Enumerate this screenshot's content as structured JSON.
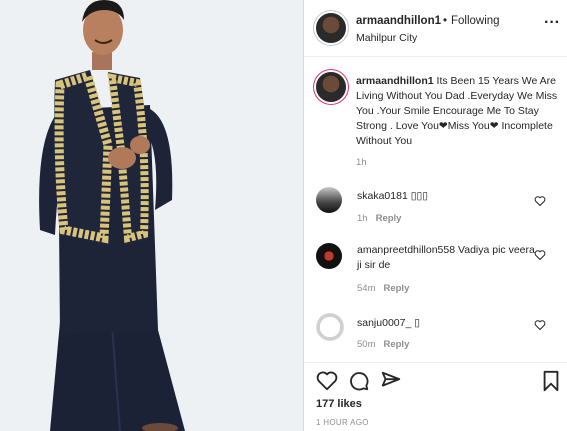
{
  "header": {
    "username": "armaandhillon1",
    "dot": "•",
    "follow_label": "Following",
    "location": "Mahilpur City",
    "more_icon": "more-options-icon",
    "more_glyph": "···"
  },
  "caption": {
    "username": "armaandhillon1",
    "text": "Its Been 15 Years We Are Living Without You Dad .Everyday We Miss You .Your Smile Encourage Me To Stay Strong . Love You❤Miss You❤ Incomplete Without You",
    "time": "1h"
  },
  "comments": [
    {
      "username": "skaka0181",
      "text": "▯▯▯",
      "time": "1h",
      "reply_label": "Reply"
    },
    {
      "username": "amanpreetdhillon558",
      "text": "Vadiya pic veera ji sir de",
      "time": "54m",
      "reply_label": "Reply"
    },
    {
      "username": "sanju0007_",
      "text": "▯",
      "time": "50m",
      "reply_label": "Reply"
    }
  ],
  "actions": {
    "like_icon": "heart-outline-icon",
    "comment_icon": "comment-icon",
    "share_icon": "share-paper-plane-icon",
    "save_icon": "bookmark-icon"
  },
  "likes": "177 likes",
  "post_time": "1 HOUR AGO",
  "colors": {
    "text": "#262626",
    "secondary": "#8e8e8e",
    "divider": "#efefef",
    "vest_gold": "#d8c37a",
    "outfit_navy": "#1e2438"
  }
}
